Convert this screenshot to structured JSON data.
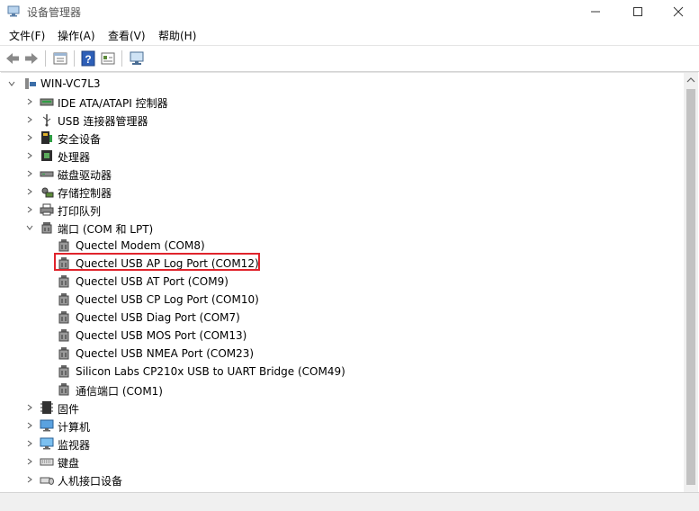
{
  "window": {
    "title": "设备管理器"
  },
  "menu": [
    {
      "label": "文件(F)"
    },
    {
      "label": "操作(A)"
    },
    {
      "label": "查看(V)"
    },
    {
      "label": "帮助(H)"
    }
  ],
  "toolbar": {
    "icons": [
      "back-arrow-icon",
      "forward-arrow-icon",
      "properties-icon",
      "help-icon",
      "show-hidden-icon",
      "monitor-icon"
    ]
  },
  "tree": {
    "root": {
      "label": "WIN-VC7L3",
      "expanded": true
    },
    "categories": [
      {
        "label": "IDE ATA/ATAPI 控制器",
        "icon": "ide-controller-icon"
      },
      {
        "label": "USB 连接器管理器",
        "icon": "usb-icon"
      },
      {
        "label": "安全设备",
        "icon": "security-device-icon"
      },
      {
        "label": "处理器",
        "icon": "processor-icon"
      },
      {
        "label": "磁盘驱动器",
        "icon": "disk-drive-icon"
      },
      {
        "label": "存储控制器",
        "icon": "storage-controller-icon"
      },
      {
        "label": "打印队列",
        "icon": "printer-icon"
      },
      {
        "label": "端口 (COM 和 LPT)",
        "icon": "port-icon",
        "expanded": true
      },
      {
        "label": "固件",
        "icon": "firmware-icon"
      },
      {
        "label": "计算机",
        "icon": "computer-icon"
      },
      {
        "label": "监视器",
        "icon": "monitor-icon"
      },
      {
        "label": "键盘",
        "icon": "keyboard-icon"
      },
      {
        "label": "人机接口设备",
        "icon": "hid-icon"
      }
    ],
    "ports": [
      {
        "label": "Quectel Modem (COM8)"
      },
      {
        "label": "Quectel USB AP Log Port (COM12)",
        "highlighted": true
      },
      {
        "label": "Quectel USB AT Port (COM9)"
      },
      {
        "label": "Quectel USB CP Log Port (COM10)"
      },
      {
        "label": "Quectel USB Diag Port (COM7)"
      },
      {
        "label": "Quectel USB MOS Port (COM13)"
      },
      {
        "label": "Quectel USB NMEA Port (COM23)"
      },
      {
        "label": "Silicon Labs CP210x USB to UART Bridge (COM49)"
      },
      {
        "label": "通信端口 (COM1)"
      }
    ]
  },
  "colors": {
    "highlight_border": "#e0242c",
    "scroll_thumb": "#c2c2c2"
  }
}
